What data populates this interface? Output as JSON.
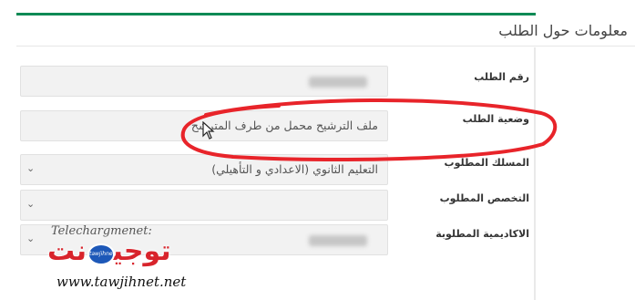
{
  "section": {
    "title": "معلومات حول الطلب"
  },
  "fields": {
    "request_number": {
      "label": "رقم الطلب",
      "value": ""
    },
    "request_status": {
      "label": "وضعية الطلب",
      "value": "ملف الترشيح محمل من طرف المترشح"
    },
    "required_track": {
      "label": "المسلك المطلوب",
      "value": "التعليم الثانوي (الاعدادي و التأهيلي)"
    },
    "required_specialty": {
      "label": "التخصص المطلوب",
      "value": ""
    },
    "required_academy": {
      "label": "الاكاديمية المطلوبة",
      "value": ""
    }
  },
  "watermark": {
    "title": "Telechargmenet:",
    "logo": "توجيه نت",
    "logo_badge": "tawjihnet",
    "url": "www.tawjihnet.net"
  },
  "colors": {
    "accent_green": "#0f8a55",
    "annotation_red": "#e8242a",
    "logo_red": "#d8242c",
    "logo_blue": "#1d58b8"
  },
  "icons": {
    "dropdown": "chevron-down-icon",
    "cursor": "mouse-pointer-icon"
  }
}
